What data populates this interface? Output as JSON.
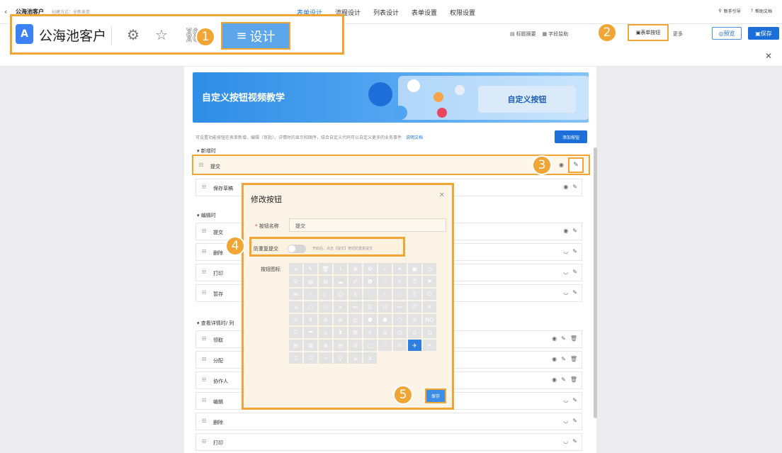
{
  "topbar": {
    "back_icon": "‹",
    "app_name": "公海池客户",
    "app_meta": "创建方式：全新表单",
    "tabs": [
      "表单设计",
      "流程设计",
      "列表设计",
      "表单设置",
      "权限设置"
    ],
    "active_tab": 0,
    "guide": "新手引导",
    "help": "帮助文档"
  },
  "subbar": {
    "tools": [
      "标题摘要",
      "字段监助"
    ],
    "form_button": "表单按钮",
    "more": "更多",
    "preview": "预览",
    "save": "保存"
  },
  "header_zoom": {
    "title": "公海池客户",
    "design": "设计"
  },
  "markers": [
    "1",
    "2",
    "3",
    "4",
    "5"
  ],
  "panel": {
    "banner_title": "自定义按钮视频教学",
    "banner_button": "自定义按钮",
    "description": "可设置功能按钮在表单新增、编辑（审批）、详情时的显示和顺序，结合自定义代码可以自定义更多的业务事件",
    "description_link": "说明文档",
    "add_button": "添加按钮",
    "sections": [
      {
        "title": "新增时",
        "rows": [
          {
            "label": "提交"
          },
          {
            "label": "保存草稿"
          }
        ]
      },
      {
        "title": "编辑时",
        "rows": [
          {
            "label": "提交"
          },
          {
            "label": "删除"
          },
          {
            "label": "打印"
          },
          {
            "label": "暂存"
          }
        ]
      },
      {
        "title": "查看详情时/ 列",
        "rows": [
          {
            "label": "领取"
          },
          {
            "label": "分配"
          },
          {
            "label": "协作人"
          },
          {
            "label": "编辑"
          },
          {
            "label": "删除"
          },
          {
            "label": "打印"
          }
        ]
      }
    ]
  },
  "modal": {
    "title": "修改按钮",
    "name_label": "按钮名称",
    "name_required": "*",
    "name_value": "提交",
    "dup_label": "防重复提交",
    "dup_tip": "开启后，点击【提交】按钮防重复提交",
    "icon_label": "按钮图标",
    "save": "保存",
    "icons": [
      "+",
      "✎",
      "🗑",
      "⤓",
      "⊕",
      "⚙",
      "✓",
      "✕",
      "▣",
      "◷",
      "⚲",
      "▤",
      "⊟",
      "☁",
      "✐",
      "❶",
      "☝",
      "⚡",
      "⎙",
      "⚑",
      "✉",
      "⚐",
      "▷",
      "☺",
      "♙",
      "♡",
      "☆",
      "⬚",
      "⎗",
      "⏲",
      "⇲",
      "☖",
      "⚇",
      "⚹",
      "⚯",
      "☰",
      "☷",
      "⚯",
      "⎚",
      "⚘",
      "☼",
      "⚱",
      "⊘",
      "⊛",
      "◎",
      "⚈",
      "⚉",
      "⚆",
      "⚞",
      "NO",
      "⎕",
      "☂",
      "⌂",
      "⧗",
      "⌘",
      "⚛",
      "⊜",
      "⌬",
      "⊙",
      "⊡",
      "⊞",
      "⊠",
      "⊗",
      "⊖",
      "⊙",
      "▢",
      "⎍",
      "⎌",
      "✈",
      "✂",
      "♖",
      "⏻",
      "⤶",
      "⚲",
      "⚶",
      "⚓"
    ],
    "selected_icon": 68
  }
}
